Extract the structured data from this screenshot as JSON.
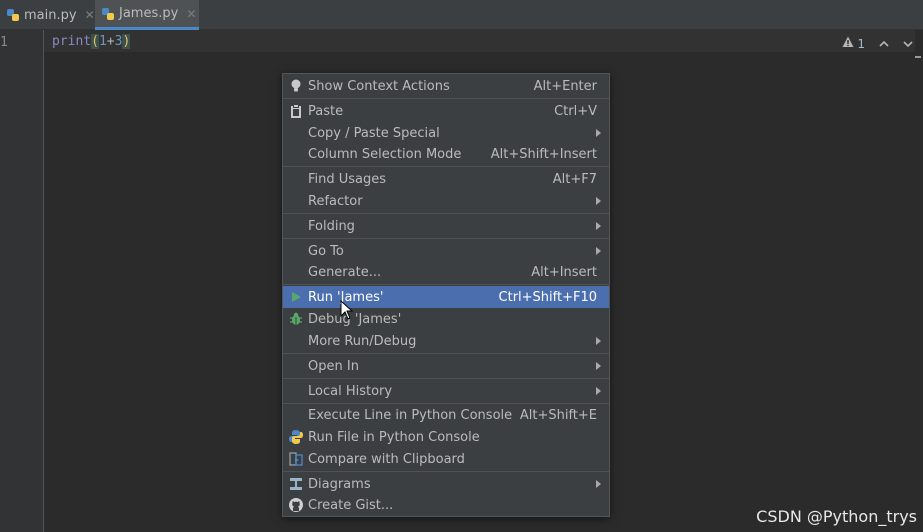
{
  "tabs": [
    {
      "label": "main.py",
      "icon": "python-file-icon",
      "active": false
    },
    {
      "label": "James.py",
      "icon": "python-file-icon",
      "active": true
    }
  ],
  "editor": {
    "line_number": "1",
    "code": {
      "fn": "print",
      "open": "(",
      "a": "1",
      "op": "+",
      "b": "3",
      "close": ")"
    }
  },
  "inspections": {
    "warning_count": "1"
  },
  "menu": {
    "show_context_actions": {
      "label": "Show Context Actions",
      "shortcut": "Alt+Enter",
      "icon": "lightbulb-icon"
    },
    "paste": {
      "label": "Paste",
      "shortcut": "Ctrl+V",
      "icon": "clipboard-icon"
    },
    "copy_paste_special": {
      "label": "Copy / Paste Special"
    },
    "column_selection_mode": {
      "label": "Column Selection Mode",
      "shortcut": "Alt+Shift+Insert"
    },
    "find_usages": {
      "label": "Find Usages",
      "shortcut": "Alt+F7"
    },
    "refactor": {
      "label": "Refactor"
    },
    "folding": {
      "label": "Folding"
    },
    "go_to": {
      "label": "Go To"
    },
    "generate": {
      "label": "Generate...",
      "shortcut": "Alt+Insert"
    },
    "run": {
      "label": "Run 'James'",
      "shortcut": "Ctrl+Shift+F10",
      "icon": "run-triangle-icon"
    },
    "debug": {
      "label": "Debug 'James'",
      "icon": "bug-icon"
    },
    "more_run_debug": {
      "label": "More Run/Debug"
    },
    "open_in": {
      "label": "Open In"
    },
    "local_history": {
      "label": "Local History"
    },
    "execute_line": {
      "label": "Execute Line in Python Console",
      "shortcut": "Alt+Shift+E"
    },
    "run_file_console": {
      "label": "Run File in Python Console",
      "icon": "python-logo-icon"
    },
    "compare_clipboard": {
      "label": "Compare with Clipboard",
      "icon": "compare-icon"
    },
    "diagrams": {
      "label": "Diagrams",
      "icon": "diagram-icon"
    },
    "create_gist": {
      "label": "Create Gist...",
      "icon": "github-icon"
    }
  },
  "watermark": "CSDN @Python_trys",
  "colors": {
    "highlight": "#4b6eaf",
    "menu_bg": "#3c3f41",
    "editor_bg": "#2b2b2b"
  }
}
